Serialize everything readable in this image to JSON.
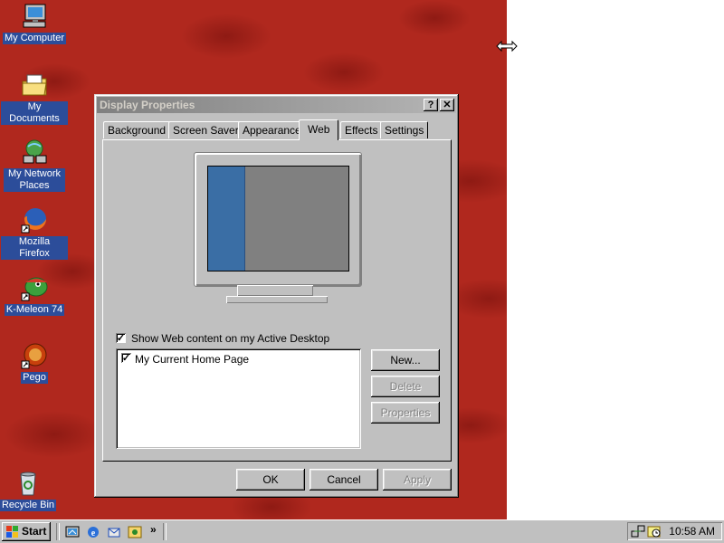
{
  "desktop": {
    "icons": [
      {
        "label": "My Computer",
        "icon": "computer-icon"
      },
      {
        "label": "My Documents",
        "icon": "folder-icon"
      },
      {
        "label": "My Network Places",
        "icon": "network-icon"
      },
      {
        "label": "Mozilla Firefox",
        "icon": "firefox-icon"
      },
      {
        "label": "K-Meleon 74",
        "icon": "kmeleon-icon"
      },
      {
        "label": "Pego",
        "icon": "pego-icon"
      },
      {
        "label": "Recycle Bin",
        "icon": "recycle-bin-icon"
      }
    ]
  },
  "window": {
    "title": "Display Properties",
    "help_button": "?",
    "close_button": "✕",
    "tabs": [
      {
        "label": "Background"
      },
      {
        "label": "Screen Saver"
      },
      {
        "label": "Appearance"
      },
      {
        "label": "Web"
      },
      {
        "label": "Effects"
      },
      {
        "label": "Settings"
      }
    ],
    "active_tab": "Web",
    "show_web_content": {
      "label": "Show Web content on my Active Desktop",
      "checked": true
    },
    "list_items": [
      {
        "label": "My Current Home Page",
        "checked": true
      }
    ],
    "side_buttons": {
      "new": "New...",
      "delete": "Delete",
      "properties": "Properties"
    },
    "footer_buttons": {
      "ok": "OK",
      "cancel": "Cancel",
      "apply": "Apply"
    }
  },
  "taskbar": {
    "start_label": "Start",
    "quick_launch": [
      "show-desktop-icon",
      "internet-explorer-icon",
      "outlook-icon",
      "media-icon"
    ],
    "overflow": "»",
    "clock": "10:58 AM",
    "tray_icons": [
      "network-tray-icon",
      "scheduler-tray-icon"
    ]
  },
  "colors": {
    "wallpaper": "#b0281e",
    "title_inactive": "#808080",
    "face": "#c0c0c0",
    "desktop_label_bg": "#2c4d9a"
  }
}
